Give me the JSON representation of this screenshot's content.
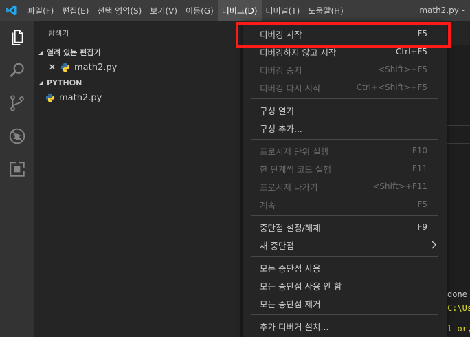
{
  "menubar": {
    "items": [
      {
        "label": "파일(F)"
      },
      {
        "label": "편집(E)"
      },
      {
        "label": "선택 영역(S)"
      },
      {
        "label": "보기(V)"
      },
      {
        "label": "이동(G)"
      },
      {
        "label": "디버그(D)",
        "active": true
      },
      {
        "label": "터미널(T)"
      },
      {
        "label": "도움말(H)"
      }
    ],
    "window_title": "math2.py -"
  },
  "activitybar": {
    "icons": [
      "files-icon",
      "search-icon",
      "source-control-icon",
      "debug-icon",
      "extensions-icon"
    ]
  },
  "sidebar": {
    "title": "탐색기",
    "open_editors_header": "열려 있는 편집기",
    "open_editors": [
      {
        "name": "math2.py"
      }
    ],
    "folder_header": "PYTHON",
    "files": [
      {
        "name": "math2.py"
      }
    ]
  },
  "terminal": {
    "lines": [
      "done",
      "C:\\Us",
      "l or,"
    ],
    "colors": [
      "#cccccc",
      "#dcdc30",
      "#dcdc30"
    ]
  },
  "debug_menu": {
    "groups": [
      [
        {
          "label": "디버깅 시작",
          "shortcut": "F5",
          "enabled": true
        },
        {
          "label": "디버깅하지 않고 시작",
          "shortcut": "Ctrl+F5",
          "enabled": true
        },
        {
          "label": "디버깅 중지",
          "shortcut": "<Shift>+F5",
          "enabled": false
        },
        {
          "label": "디버깅 다시 시작",
          "shortcut": "Ctrl+<Shift>+F5",
          "enabled": false
        }
      ],
      [
        {
          "label": "구성 열기",
          "shortcut": "",
          "enabled": true
        },
        {
          "label": "구성 추가...",
          "shortcut": "",
          "enabled": true
        }
      ],
      [
        {
          "label": "프로시저 단위 실행",
          "shortcut": "F10",
          "enabled": false
        },
        {
          "label": "한 단계씩 코드 실행",
          "shortcut": "F11",
          "enabled": false
        },
        {
          "label": "프로시저 나가기",
          "shortcut": "<Shift>+F11",
          "enabled": false
        },
        {
          "label": "계속",
          "shortcut": "F5",
          "enabled": false
        }
      ],
      [
        {
          "label": "중단점 설정/해제",
          "shortcut": "F9",
          "enabled": true
        },
        {
          "label": "새 중단점",
          "shortcut": "",
          "enabled": true,
          "submenu": true
        }
      ],
      [
        {
          "label": "모든 중단점 사용",
          "shortcut": "",
          "enabled": true
        },
        {
          "label": "모든 중단점 사용 안 함",
          "shortcut": "",
          "enabled": true
        },
        {
          "label": "모든 중단점 제거",
          "shortcut": "",
          "enabled": true
        }
      ],
      [
        {
          "label": "추가 디버거 설치...",
          "shortcut": "",
          "enabled": true
        }
      ]
    ]
  },
  "colors": {
    "accent": "#007acc",
    "highlight": "#ff1a1a",
    "python_blue": "#3572a5",
    "python_yellow": "#ffd43b"
  }
}
